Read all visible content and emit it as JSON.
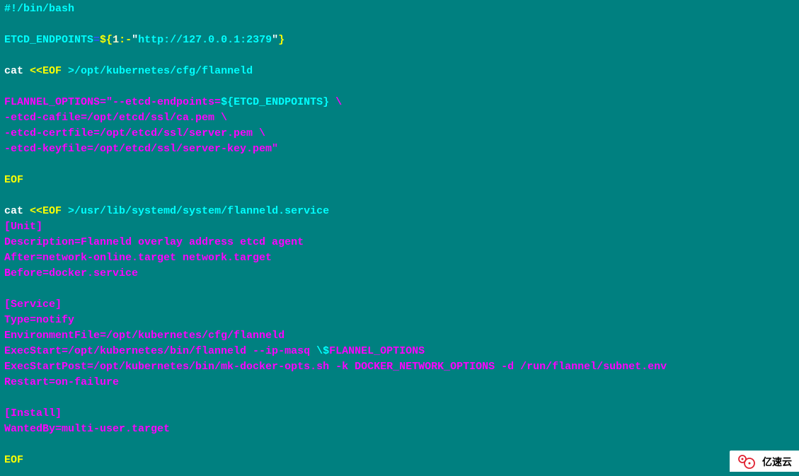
{
  "lines": [
    {
      "segments": [
        {
          "class": "cyan",
          "text": "#!/bin/bash"
        }
      ]
    },
    {
      "segments": [
        {
          "class": "",
          "text": " "
        }
      ]
    },
    {
      "segments": [
        {
          "class": "cyan",
          "text": "ETCD_ENDPOINTS"
        },
        {
          "class": "blue",
          "text": "="
        },
        {
          "class": "yellow",
          "text": "${"
        },
        {
          "class": "cream",
          "text": "1"
        },
        {
          "class": "yellow",
          "text": ":-"
        },
        {
          "class": "white",
          "text": "\""
        },
        {
          "class": "cyan",
          "text": "http://127.0.0.1:2379"
        },
        {
          "class": "white",
          "text": "\""
        },
        {
          "class": "yellow",
          "text": "}"
        }
      ]
    },
    {
      "segments": [
        {
          "class": "",
          "text": " "
        }
      ]
    },
    {
      "segments": [
        {
          "class": "white",
          "text": "cat "
        },
        {
          "class": "yellow",
          "text": "<<EOF "
        },
        {
          "class": "cyan",
          "text": ">/opt/kubernetes/cfg/flanneld"
        }
      ]
    },
    {
      "segments": [
        {
          "class": "",
          "text": " "
        }
      ]
    },
    {
      "segments": [
        {
          "class": "magenta",
          "text": "FLANNEL_OPTIONS=\"--etcd-endpoints="
        },
        {
          "class": "cyan",
          "text": "${ETCD_ENDPOINTS}"
        },
        {
          "class": "magenta",
          "text": " \\"
        }
      ]
    },
    {
      "segments": [
        {
          "class": "magenta",
          "text": "-etcd-cafile=/opt/etcd/ssl/ca.pem \\"
        }
      ]
    },
    {
      "segments": [
        {
          "class": "magenta",
          "text": "-etcd-certfile=/opt/etcd/ssl/server.pem \\"
        }
      ]
    },
    {
      "segments": [
        {
          "class": "magenta",
          "text": "-etcd-keyfile=/opt/etcd/ssl/server-key.pem\""
        }
      ]
    },
    {
      "segments": [
        {
          "class": "",
          "text": " "
        }
      ]
    },
    {
      "segments": [
        {
          "class": "yellow",
          "text": "EOF"
        }
      ]
    },
    {
      "segments": [
        {
          "class": "",
          "text": " "
        }
      ]
    },
    {
      "segments": [
        {
          "class": "white",
          "text": "cat "
        },
        {
          "class": "yellow",
          "text": "<<EOF "
        },
        {
          "class": "cyan",
          "text": ">/usr/lib/systemd/system/flanneld.service"
        }
      ]
    },
    {
      "segments": [
        {
          "class": "magenta",
          "text": "[Unit]"
        }
      ]
    },
    {
      "segments": [
        {
          "class": "magenta",
          "text": "Description=Flanneld overlay address etcd agent"
        }
      ]
    },
    {
      "segments": [
        {
          "class": "magenta",
          "text": "After=network-online.target network.target"
        }
      ]
    },
    {
      "segments": [
        {
          "class": "magenta",
          "text": "Before=docker.service"
        }
      ]
    },
    {
      "segments": [
        {
          "class": "",
          "text": " "
        }
      ]
    },
    {
      "segments": [
        {
          "class": "magenta",
          "text": "[Service]"
        }
      ]
    },
    {
      "segments": [
        {
          "class": "magenta",
          "text": "Type=notify"
        }
      ]
    },
    {
      "segments": [
        {
          "class": "magenta",
          "text": "EnvironmentFile=/opt/kubernetes/cfg/flanneld"
        }
      ]
    },
    {
      "segments": [
        {
          "class": "magenta",
          "text": "ExecStart=/opt/kubernetes/bin/flanneld --ip-masq "
        },
        {
          "class": "cyan",
          "text": "\\$"
        },
        {
          "class": "magenta",
          "text": "FLANNEL_OPTIONS"
        }
      ]
    },
    {
      "segments": [
        {
          "class": "magenta",
          "text": "ExecStartPost=/opt/kubernetes/bin/mk-docker-opts.sh -k DOCKER_NETWORK_OPTIONS -d /run/flannel/subnet.env"
        }
      ]
    },
    {
      "segments": [
        {
          "class": "magenta",
          "text": "Restart=on-failure"
        }
      ]
    },
    {
      "segments": [
        {
          "class": "",
          "text": " "
        }
      ]
    },
    {
      "segments": [
        {
          "class": "magenta",
          "text": "[Install]"
        }
      ]
    },
    {
      "segments": [
        {
          "class": "magenta",
          "text": "WantedBy=multi-user.target"
        }
      ]
    },
    {
      "segments": [
        {
          "class": "",
          "text": " "
        }
      ]
    },
    {
      "segments": [
        {
          "class": "yellow",
          "text": "EOF"
        }
      ]
    }
  ],
  "watermark": {
    "text": "亿速云"
  }
}
